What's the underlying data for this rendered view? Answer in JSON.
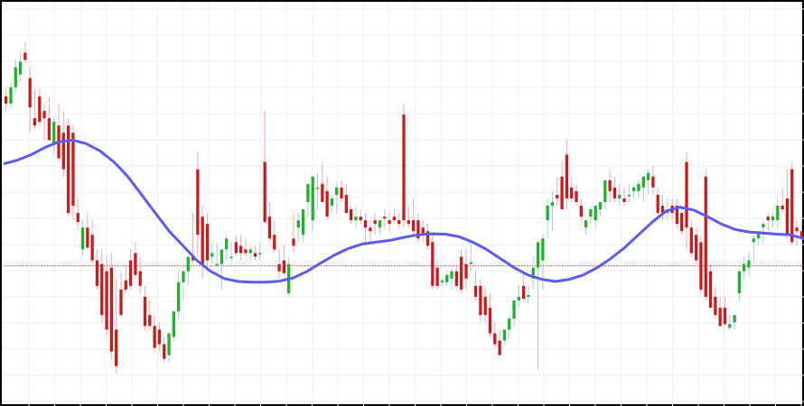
{
  "chart_data": {
    "type": "candlestick",
    "title": "",
    "xlabel": "",
    "ylabel": "",
    "grid": true,
    "ylim": [
      0,
      100
    ],
    "reference_line": {
      "value": 33.5,
      "color": "#e03a3a",
      "style": "dotted"
    },
    "moving_average": {
      "color": "#5c5cf0",
      "values": [
        61.5,
        62.5,
        64.0,
        66.0,
        67.5,
        68.0,
        67.0,
        65.0,
        62.0,
        58.0,
        53.0,
        48.0,
        43.0,
        39.0,
        35.0,
        32.0,
        30.0,
        29.2,
        29.0,
        29.0,
        29.3,
        30.2,
        32.0,
        34.3,
        36.5,
        38.3,
        39.5,
        40.0,
        40.5,
        41.3,
        42.0,
        42.3,
        42.2,
        41.5,
        40.0,
        38.0,
        35.5,
        33.0,
        31.0,
        29.8,
        29.2,
        29.8,
        31.0,
        33.0,
        35.5,
        38.5,
        42.0,
        45.5,
        48.5,
        49.6,
        48.8,
        47.0,
        45.0,
        43.5,
        42.8,
        42.5,
        42.2,
        42.0,
        41.0
      ]
    },
    "candles": [
      {
        "o": 80.0,
        "h": 82.0,
        "l": 76.0,
        "c": 78.0
      },
      {
        "o": 78.0,
        "h": 84.0,
        "l": 77.0,
        "c": 82.5
      },
      {
        "o": 82.5,
        "h": 90.0,
        "l": 81.0,
        "c": 88.0
      },
      {
        "o": 86.0,
        "h": 92.0,
        "l": 84.0,
        "c": 89.5
      },
      {
        "o": 92.0,
        "h": 95.0,
        "l": 89.0,
        "c": 90.0
      },
      {
        "o": 85.0,
        "h": 88.0,
        "l": 70.0,
        "c": 77.0
      },
      {
        "o": 74.0,
        "h": 82.0,
        "l": 71.0,
        "c": 72.0
      },
      {
        "o": 80.0,
        "h": 82.0,
        "l": 72.0,
        "c": 73.0
      },
      {
        "o": 76.0,
        "h": 78.0,
        "l": 68.0,
        "c": 74.0
      },
      {
        "o": 74.0,
        "h": 80.0,
        "l": 68.0,
        "c": 68.0
      },
      {
        "o": 67.0,
        "h": 74.0,
        "l": 64.0,
        "c": 73.0
      },
      {
        "o": 72.0,
        "h": 78.0,
        "l": 62.0,
        "c": 63.0
      },
      {
        "o": 70.0,
        "h": 76.0,
        "l": 58.0,
        "c": 60.0
      },
      {
        "o": 72.0,
        "h": 74.0,
        "l": 47.0,
        "c": 48.0
      },
      {
        "o": 70.0,
        "h": 72.0,
        "l": 46.0,
        "c": 50.0
      },
      {
        "o": 48.0,
        "h": 52.0,
        "l": 44.0,
        "c": 45.5
      },
      {
        "o": 38.0,
        "h": 46.0,
        "l": 36.0,
        "c": 44.0
      },
      {
        "o": 44.0,
        "h": 48.0,
        "l": 38.0,
        "c": 38.5
      },
      {
        "o": 42.0,
        "h": 46.0,
        "l": 34.0,
        "c": 35.0
      },
      {
        "o": 35.0,
        "h": 38.0,
        "l": 27.0,
        "c": 28.0
      },
      {
        "o": 34.0,
        "h": 38.0,
        "l": 18.0,
        "c": 20.0
      },
      {
        "o": 32.0,
        "h": 36.0,
        "l": 14.0,
        "c": 16.0
      },
      {
        "o": 33.0,
        "h": 37.0,
        "l": 8.0,
        "c": 10.0
      },
      {
        "o": 16.0,
        "h": 30.0,
        "l": 4.0,
        "c": 6.0
      },
      {
        "o": 27.0,
        "h": 32.0,
        "l": 20.0,
        "c": 20.0
      },
      {
        "o": 29.5,
        "h": 34.0,
        "l": 26.0,
        "c": 27.0
      },
      {
        "o": 35.0,
        "h": 38.0,
        "l": 27.0,
        "c": 28.0
      },
      {
        "o": 37.0,
        "h": 40.0,
        "l": 30.0,
        "c": 31.0
      },
      {
        "o": 32.0,
        "h": 36.0,
        "l": 26.0,
        "c": 28.0
      },
      {
        "o": 25.0,
        "h": 28.0,
        "l": 16.0,
        "c": 17.0
      },
      {
        "o": 20.0,
        "h": 24.0,
        "l": 16.0,
        "c": 17.0
      },
      {
        "o": 17.0,
        "h": 20.0,
        "l": 10.0,
        "c": 11.0
      },
      {
        "o": 16.0,
        "h": 18.0,
        "l": 10.0,
        "c": 12.0
      },
      {
        "o": 12.0,
        "h": 14.0,
        "l": 7.0,
        "c": 8.0
      },
      {
        "o": 9.0,
        "h": 12.0,
        "l": 7.0,
        "c": 15.0
      },
      {
        "o": 14.0,
        "h": 16.0,
        "l": 13.0,
        "c": 21.0
      },
      {
        "o": 21.0,
        "h": 32.0,
        "l": 19.0,
        "c": 29.0
      },
      {
        "o": 29.0,
        "h": 32.0,
        "l": 24.0,
        "c": 32.0
      },
      {
        "o": 32.0,
        "h": 35.0,
        "l": 28.0,
        "c": 36.0
      },
      {
        "o": 36.0,
        "h": 48.0,
        "l": 34.0,
        "c": 35.0
      },
      {
        "o": 60.0,
        "h": 65.0,
        "l": 36.0,
        "c": 42.0
      },
      {
        "o": 47.0,
        "h": 50.0,
        "l": 30.0,
        "c": 34.0
      },
      {
        "o": 45.0,
        "h": 48.0,
        "l": 33.0,
        "c": 35.0
      },
      {
        "o": 36.0,
        "h": 40.0,
        "l": 34.0,
        "c": 37.0
      },
      {
        "o": 34.0,
        "h": 40.0,
        "l": 33.0,
        "c": 34.0
      },
      {
        "o": 34.0,
        "h": 38.0,
        "l": 27.0,
        "c": 38.0
      },
      {
        "o": 38.0,
        "h": 42.0,
        "l": 35.0,
        "c": 41.0
      },
      {
        "o": 36.0,
        "h": 40.0,
        "l": 34.0,
        "c": 36.0
      },
      {
        "o": 40.0,
        "h": 42.0,
        "l": 36.0,
        "c": 37.0
      },
      {
        "o": 39.0,
        "h": 42.0,
        "l": 35.0,
        "c": 37.0
      },
      {
        "o": 38.0,
        "h": 41.0,
        "l": 36.0,
        "c": 37.0
      },
      {
        "o": 37.0,
        "h": 39.0,
        "l": 35.0,
        "c": 38.0
      },
      {
        "o": 37.0,
        "h": 39.0,
        "l": 35.0,
        "c": 36.0
      },
      {
        "o": 37.0,
        "h": 40.0,
        "l": 35.0,
        "c": 37.0
      },
      {
        "o": 62.0,
        "h": 76.0,
        "l": 45.0,
        "c": 45.5
      },
      {
        "o": 47.0,
        "h": 51.0,
        "l": 40.0,
        "c": 41.0
      },
      {
        "o": 42.0,
        "h": 46.0,
        "l": 37.0,
        "c": 38.0
      },
      {
        "o": 34.0,
        "h": 38.0,
        "l": 30.0,
        "c": 32.0
      },
      {
        "o": 35.0,
        "h": 39.0,
        "l": 31.0,
        "c": 31.5
      },
      {
        "o": 26.0,
        "h": 36.0,
        "l": 25.0,
        "c": 34.0
      },
      {
        "o": 41.0,
        "h": 48.0,
        "l": 37.0,
        "c": 39.0
      },
      {
        "o": 44.0,
        "h": 48.0,
        "l": 40.0,
        "c": 46.0
      },
      {
        "o": 42.0,
        "h": 48.0,
        "l": 40.0,
        "c": 49.0
      },
      {
        "o": 51.0,
        "h": 55.0,
        "l": 47.0,
        "c": 56.0
      },
      {
        "o": 46.0,
        "h": 58.0,
        "l": 43.0,
        "c": 58.0
      },
      {
        "o": 55.0,
        "h": 59.0,
        "l": 49.0,
        "c": 55.0
      },
      {
        "o": 56.0,
        "h": 62.0,
        "l": 52.0,
        "c": 51.0
      },
      {
        "o": 54.0,
        "h": 58.0,
        "l": 46.0,
        "c": 47.0
      },
      {
        "o": 50.0,
        "h": 53.0,
        "l": 48.0,
        "c": 52.0
      },
      {
        "o": 53.0,
        "h": 56.0,
        "l": 48.0,
        "c": 55.0
      },
      {
        "o": 55.0,
        "h": 57.0,
        "l": 51.0,
        "c": 52.0
      },
      {
        "o": 53.0,
        "h": 56.0,
        "l": 48.0,
        "c": 48.0
      },
      {
        "o": 49.0,
        "h": 50.0,
        "l": 45.0,
        "c": 46.0
      },
      {
        "o": 46.0,
        "h": 50.0,
        "l": 44.0,
        "c": 47.0
      },
      {
        "o": 47.0,
        "h": 49.0,
        "l": 45.0,
        "c": 46.0
      },
      {
        "o": 46.0,
        "h": 48.0,
        "l": 39.0,
        "c": 44.0
      },
      {
        "o": 44.0,
        "h": 46.0,
        "l": 40.0,
        "c": 43.0
      },
      {
        "o": 46.0,
        "h": 48.0,
        "l": 42.0,
        "c": 45.0
      },
      {
        "o": 44.0,
        "h": 46.0,
        "l": 42.0,
        "c": 46.0
      },
      {
        "o": 47.0,
        "h": 49.0,
        "l": 44.0,
        "c": 46.5
      },
      {
        "o": 46.0,
        "h": 48.0,
        "l": 43.0,
        "c": 45.0
      },
      {
        "o": 47.0,
        "h": 49.0,
        "l": 45.0,
        "c": 46.0
      },
      {
        "o": 46.0,
        "h": 48.0,
        "l": 44.0,
        "c": 45.0
      },
      {
        "o": 75.0,
        "h": 78.0,
        "l": 44.0,
        "c": 46.0
      },
      {
        "o": 46.0,
        "h": 50.0,
        "l": 44.0,
        "c": 45.0
      },
      {
        "o": 46.0,
        "h": 52.0,
        "l": 42.0,
        "c": 43.0
      },
      {
        "o": 46.0,
        "h": 48.0,
        "l": 40.0,
        "c": 41.0
      },
      {
        "o": 44.0,
        "h": 46.0,
        "l": 40.0,
        "c": 42.0
      },
      {
        "o": 43.0,
        "h": 45.0,
        "l": 38.0,
        "c": 39.0
      },
      {
        "o": 40.0,
        "h": 42.0,
        "l": 27.0,
        "c": 28.0
      },
      {
        "o": 33.0,
        "h": 35.0,
        "l": 27.0,
        "c": 28.0
      },
      {
        "o": 29.0,
        "h": 30.0,
        "l": 28.0,
        "c": 29.5
      },
      {
        "o": 29.0,
        "h": 32.0,
        "l": 28.0,
        "c": 31.0
      },
      {
        "o": 30.0,
        "h": 33.0,
        "l": 27.0,
        "c": 32.0
      },
      {
        "o": 32.0,
        "h": 34.0,
        "l": 27.0,
        "c": 28.0
      },
      {
        "o": 36.0,
        "h": 38.0,
        "l": 26.0,
        "c": 27.0
      },
      {
        "o": 34.0,
        "h": 38.0,
        "l": 27.0,
        "c": 30.0
      },
      {
        "o": 34.0,
        "h": 40.0,
        "l": 32.0,
        "c": 34.5
      },
      {
        "o": 28.0,
        "h": 32.0,
        "l": 24.0,
        "c": 25.0
      },
      {
        "o": 28.0,
        "h": 30.0,
        "l": 18.0,
        "c": 20.0
      },
      {
        "o": 25.0,
        "h": 28.0,
        "l": 18.0,
        "c": 20.0
      },
      {
        "o": 22.0,
        "h": 26.0,
        "l": 14.0,
        "c": 15.0
      },
      {
        "o": 15.0,
        "h": 18.0,
        "l": 11.0,
        "c": 12.0
      },
      {
        "o": 13.0,
        "h": 16.0,
        "l": 10.0,
        "c": 9.0
      },
      {
        "o": 13.0,
        "h": 16.0,
        "l": 12.0,
        "c": 16.0
      },
      {
        "o": 16.0,
        "h": 20.0,
        "l": 14.0,
        "c": 19.0
      },
      {
        "o": 19.0,
        "h": 24.0,
        "l": 17.0,
        "c": 24.0
      },
      {
        "o": 24.0,
        "h": 28.0,
        "l": 22.0,
        "c": 25.0
      },
      {
        "o": 28.0,
        "h": 32.0,
        "l": 24.0,
        "c": 24.5
      },
      {
        "o": 25.0,
        "h": 28.0,
        "l": 23.0,
        "c": 25.5
      },
      {
        "o": 30.0,
        "h": 36.0,
        "l": 27.0,
        "c": 33.0
      },
      {
        "o": 33.0,
        "h": 37.0,
        "l": 5.0,
        "c": 40.0
      },
      {
        "o": 35.0,
        "h": 42.0,
        "l": 27.0,
        "c": 41.0
      },
      {
        "o": 46.0,
        "h": 52.0,
        "l": 41.0,
        "c": 50.0
      },
      {
        "o": 50.0,
        "h": 54.0,
        "l": 43.0,
        "c": 51.0
      },
      {
        "o": 53.0,
        "h": 58.0,
        "l": 50.0,
        "c": 52.0
      },
      {
        "o": 58.0,
        "h": 62.0,
        "l": 49.0,
        "c": 49.0
      },
      {
        "o": 64.0,
        "h": 68.0,
        "l": 49.0,
        "c": 52.0
      },
      {
        "o": 55.0,
        "h": 58.0,
        "l": 51.0,
        "c": 52.0
      },
      {
        "o": 54.0,
        "h": 56.0,
        "l": 50.0,
        "c": 51.0
      },
      {
        "o": 50.0,
        "h": 52.0,
        "l": 46.0,
        "c": 47.0
      },
      {
        "o": 44.0,
        "h": 46.0,
        "l": 42.0,
        "c": 46.0
      },
      {
        "o": 47.0,
        "h": 50.0,
        "l": 45.0,
        "c": 49.0
      },
      {
        "o": 46.0,
        "h": 50.0,
        "l": 44.0,
        "c": 50.0
      },
      {
        "o": 49.0,
        "h": 51.0,
        "l": 47.0,
        "c": 51.0
      },
      {
        "o": 51.0,
        "h": 56.0,
        "l": 49.0,
        "c": 57.0
      },
      {
        "o": 57.0,
        "h": 60.0,
        "l": 51.0,
        "c": 54.0
      },
      {
        "o": 55.0,
        "h": 58.0,
        "l": 51.0,
        "c": 52.0
      },
      {
        "o": 52.0,
        "h": 56.0,
        "l": 50.0,
        "c": 53.0
      },
      {
        "o": 52.0,
        "h": 55.0,
        "l": 50.0,
        "c": 51.0
      },
      {
        "o": 53.0,
        "h": 56.0,
        "l": 51.0,
        "c": 53.0
      },
      {
        "o": 54.0,
        "h": 56.0,
        "l": 52.0,
        "c": 55.0
      },
      {
        "o": 54.0,
        "h": 57.0,
        "l": 52.0,
        "c": 56.0
      },
      {
        "o": 55.0,
        "h": 57.0,
        "l": 51.0,
        "c": 58.0
      },
      {
        "o": 57.0,
        "h": 60.0,
        "l": 53.0,
        "c": 59.0
      },
      {
        "o": 58.0,
        "h": 61.0,
        "l": 53.0,
        "c": 55.0
      },
      {
        "o": 53.0,
        "h": 55.0,
        "l": 47.0,
        "c": 48.0
      },
      {
        "o": 50.0,
        "h": 53.0,
        "l": 46.0,
        "c": 48.0
      },
      {
        "o": 48.0,
        "h": 52.0,
        "l": 46.0,
        "c": 49.0
      },
      {
        "o": 50.0,
        "h": 52.0,
        "l": 46.0,
        "c": 48.0
      },
      {
        "o": 50.0,
        "h": 52.0,
        "l": 44.0,
        "c": 45.0
      },
      {
        "o": 48.0,
        "h": 50.0,
        "l": 42.0,
        "c": 43.0
      },
      {
        "o": 62.0,
        "h": 65.0,
        "l": 38.0,
        "c": 44.0
      },
      {
        "o": 44.0,
        "h": 46.0,
        "l": 36.0,
        "c": 37.0
      },
      {
        "o": 42.0,
        "h": 44.0,
        "l": 34.0,
        "c": 35.0
      },
      {
        "o": 40.0,
        "h": 42.0,
        "l": 26.0,
        "c": 27.0
      },
      {
        "o": 58.0,
        "h": 60.0,
        "l": 24.0,
        "c": 25.0
      },
      {
        "o": 32.0,
        "h": 34.0,
        "l": 22.0,
        "c": 22.0
      },
      {
        "o": 25.0,
        "h": 28.0,
        "l": 19.0,
        "c": 20.0
      },
      {
        "o": 22.0,
        "h": 25.0,
        "l": 17.0,
        "c": 17.0
      },
      {
        "o": 22.0,
        "h": 25.0,
        "l": 17.0,
        "c": 17.5
      },
      {
        "o": 16.5,
        "h": 20.0,
        "l": 16.0,
        "c": 17.5
      },
      {
        "o": 18.0,
        "h": 20.0,
        "l": 16.0,
        "c": 20.0
      },
      {
        "o": 26.0,
        "h": 32.0,
        "l": 24.0,
        "c": 32.0
      },
      {
        "o": 32.0,
        "h": 36.0,
        "l": 30.0,
        "c": 34.0
      },
      {
        "o": 33.0,
        "h": 37.0,
        "l": 31.0,
        "c": 35.0
      },
      {
        "o": 40.0,
        "h": 42.0,
        "l": 34.0,
        "c": 41.0
      },
      {
        "o": 41.0,
        "h": 43.0,
        "l": 39.0,
        "c": 43.0
      },
      {
        "o": 44.0,
        "h": 46.0,
        "l": 40.0,
        "c": 45.0
      },
      {
        "o": 47.0,
        "h": 48.0,
        "l": 43.0,
        "c": 46.0
      },
      {
        "o": 46.0,
        "h": 48.0,
        "l": 44.0,
        "c": 47.0
      },
      {
        "o": 46.0,
        "h": 52.0,
        "l": 44.0,
        "c": 50.0
      },
      {
        "o": 50.0,
        "h": 55.0,
        "l": 48.0,
        "c": 49.0
      },
      {
        "o": 52.0,
        "h": 60.0,
        "l": 48.0,
        "c": 42.0
      },
      {
        "o": 60.0,
        "h": 62.0,
        "l": 39.0,
        "c": 40.0
      },
      {
        "o": 44.0,
        "h": 46.0,
        "l": 39.0,
        "c": 43.0
      },
      {
        "o": 43.0,
        "h": 46.0,
        "l": 41.0,
        "c": 41.0
      }
    ]
  }
}
